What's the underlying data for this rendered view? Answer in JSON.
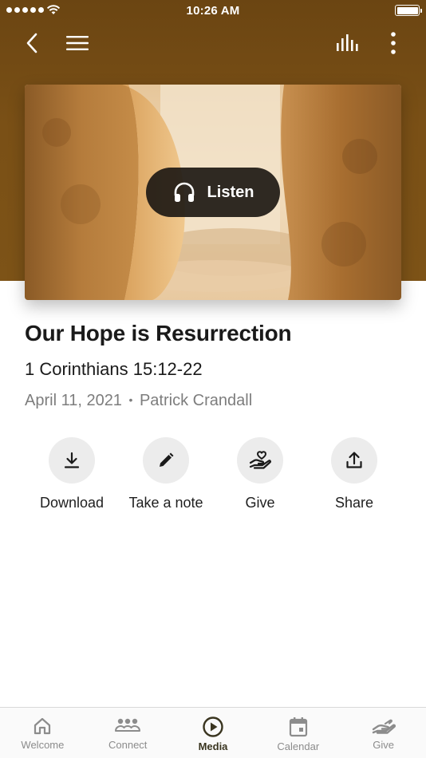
{
  "status_bar": {
    "time": "10:26 AM"
  },
  "sermon": {
    "title": "Our Hope is Resurrection",
    "scripture": "1 Corinthians 15:12-22",
    "date": "April 11, 2021",
    "speaker": "Patrick Crandall",
    "meta_separator": "•",
    "listen_label": "Listen"
  },
  "actions": [
    {
      "label": "Download",
      "icon": "download-icon"
    },
    {
      "label": "Take a note",
      "icon": "pencil-icon"
    },
    {
      "label": "Give",
      "icon": "heart-hand-icon"
    },
    {
      "label": "Share",
      "icon": "share-icon"
    }
  ],
  "tabs": [
    {
      "label": "Welcome",
      "icon": "home-icon",
      "active": false
    },
    {
      "label": "Connect",
      "icon": "people-icon",
      "active": false
    },
    {
      "label": "Media",
      "icon": "play-circle-icon",
      "active": true
    },
    {
      "label": "Calendar",
      "icon": "calendar-icon",
      "active": false
    },
    {
      "label": "Give",
      "icon": "give-icon",
      "active": false
    }
  ],
  "colors": {
    "header_brown": "#6b4512",
    "listen_button": "#1e1914",
    "action_circle": "#ececec",
    "tab_active": "#3a3520",
    "tab_inactive": "#8c8c8c"
  }
}
